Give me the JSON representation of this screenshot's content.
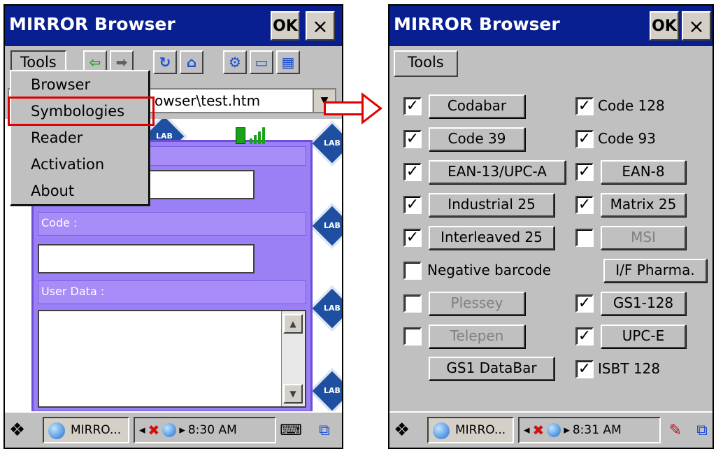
{
  "left_screen": {
    "title": "MIRROR Browser",
    "ok_label": "OK",
    "close_label": "×",
    "menu": {
      "tools_label": "Tools"
    },
    "toolbar_icons": [
      "back-icon",
      "forward-icon",
      "refresh-icon",
      "home-icon",
      "settings-icon",
      "keyboard-icon",
      "grid-icon"
    ],
    "address_text": "owser\\test.htm",
    "dropdown_items": [
      "Browser",
      "Symbologies",
      "Reader",
      "Activation",
      "About"
    ],
    "form": {
      "code_label": "Code :",
      "user_data_label": "User Data :"
    },
    "lab_badge": "LAB",
    "taskbar": {
      "app_label": "MIRRO...",
      "time": "8:30 AM"
    }
  },
  "right_screen": {
    "title": "MIRROR Browser",
    "ok_label": "OK",
    "close_label": "×",
    "tools_label": "Tools",
    "check_mark": "✓",
    "left_column": [
      {
        "checked": true,
        "label": "Codabar",
        "enabled": true
      },
      {
        "checked": true,
        "label": "Code 39",
        "enabled": true
      },
      {
        "checked": true,
        "label": "EAN-13/UPC-A",
        "enabled": true
      },
      {
        "checked": true,
        "label": "Industrial 25",
        "enabled": true
      },
      {
        "checked": true,
        "label": "Interleaved 25",
        "enabled": true
      },
      {
        "checked": false,
        "label": "Negative barcode"
      },
      {
        "checked": false,
        "label": "Plessey",
        "enabled": false
      },
      {
        "checked": false,
        "label": "Telepen",
        "enabled": false
      },
      {
        "label": "GS1 DataBar",
        "enabled": true
      }
    ],
    "right_column": [
      {
        "checked": true,
        "label": "Code 128"
      },
      {
        "checked": true,
        "label": "Code 93"
      },
      {
        "checked": true,
        "label": "EAN-8",
        "enabled": true
      },
      {
        "checked": true,
        "label": "Matrix 25",
        "enabled": true
      },
      {
        "checked": false,
        "label": "MSI",
        "enabled": false
      },
      {
        "label": "I/F Pharma.",
        "enabled": true
      },
      {
        "checked": true,
        "label": "GS1-128",
        "enabled": true
      },
      {
        "checked": true,
        "label": "UPC-E",
        "enabled": true
      },
      {
        "checked": true,
        "label": "ISBT 128"
      }
    ],
    "taskbar": {
      "app_label": "MIRRO...",
      "time": "8:31 AM"
    }
  },
  "colors": {
    "titlebar": "#0a1f8f",
    "form_purple": "#9a7ff5",
    "highlight_red": "#e00000"
  }
}
